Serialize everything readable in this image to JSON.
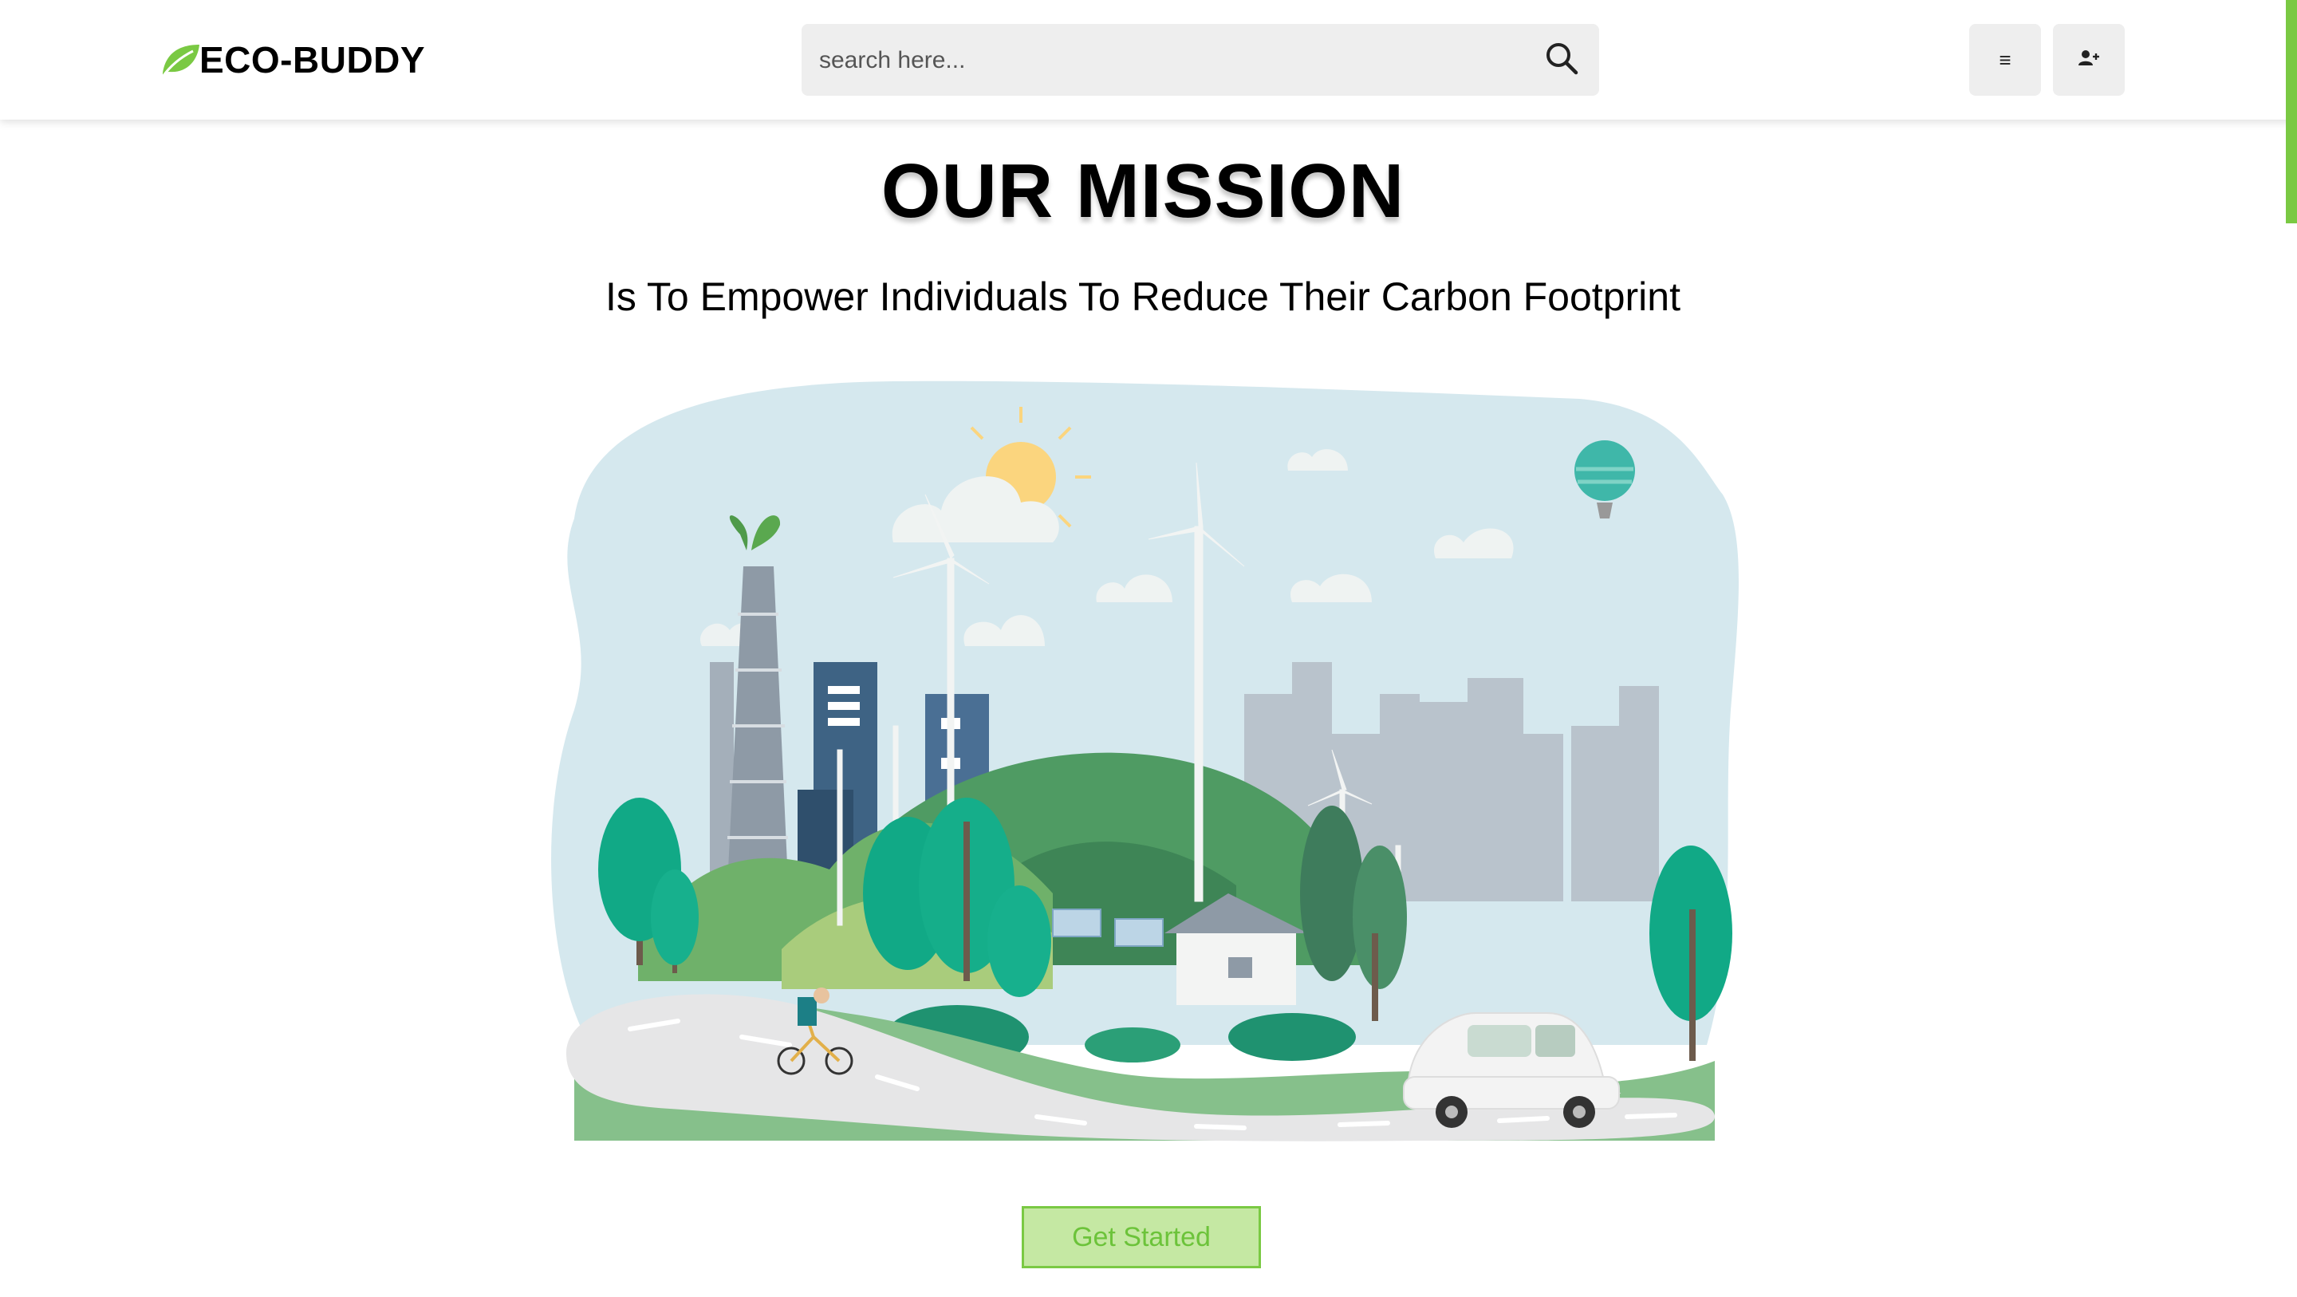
{
  "header": {
    "brand": "ECO-BUDDY",
    "logo_icon": "leaf-icon",
    "search_placeholder": "search here...",
    "search_icon": "search-icon",
    "menu_icon": "menu-icon",
    "menu_glyph": "≡",
    "user_icon": "user-plus-icon"
  },
  "hero": {
    "title": "OUR MISSION",
    "subtitle": "Is To Empower Individuals To Reduce Their Carbon Footprint",
    "illustration": "green-city-illustration",
    "cta_label": "Get Started"
  },
  "colors": {
    "accent": "#7ac943",
    "button_bg": "#c5e8a3",
    "button_text": "#6cc33a",
    "field_bg": "#eeeeee"
  }
}
